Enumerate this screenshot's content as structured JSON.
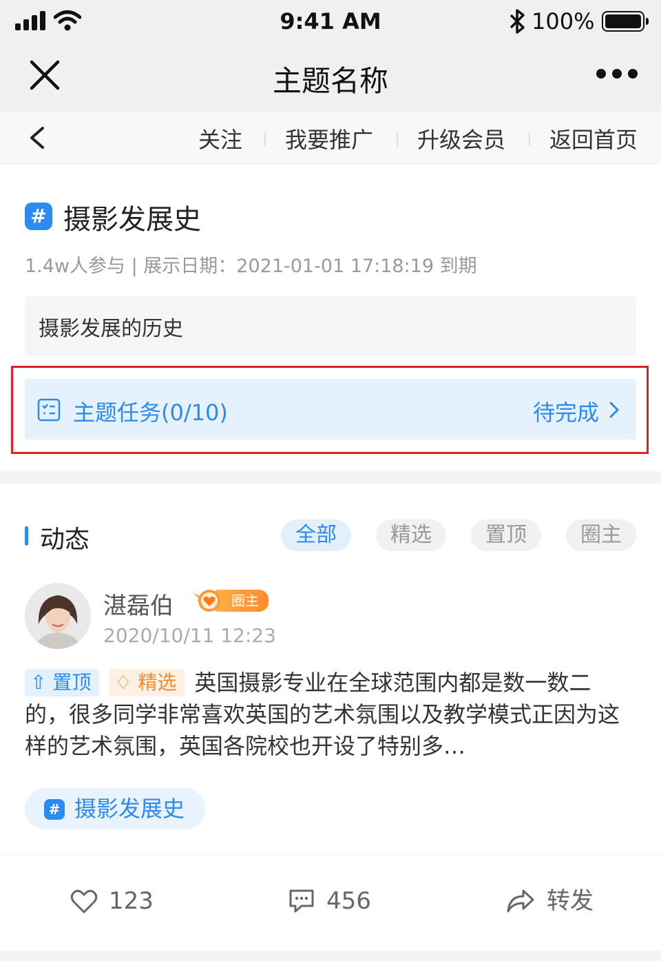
{
  "status_bar": {
    "time": "9:41 AM",
    "battery": "100%"
  },
  "nav": {
    "title": "主题名称"
  },
  "toolbar": {
    "items": [
      "关注",
      "我要推广",
      "升级会员",
      "返回首页"
    ]
  },
  "topic": {
    "hash": "#",
    "title": "摄影发展史",
    "meta": "1.4w人参与 | 展示日期：2021-01-01 17:18:19 到期",
    "description": "摄影发展的历史",
    "task_label": "主题任务(0/10)",
    "task_status": "待完成"
  },
  "feed": {
    "title": "动态",
    "filters": [
      "全部",
      "精选",
      "置顶",
      "圈主"
    ],
    "active_filter": "全部",
    "post": {
      "author": "湛磊伯",
      "badge": "圈主",
      "time": "2020/10/11 12:23",
      "tag_top": "置顶",
      "tag_pick": "精选",
      "text": "英国摄影专业在全球范围内都是数一数二的，很多同学非常喜欢英国的艺术氛围以及教学模式正因为这样的艺术氛围，英国各院校也开设了特别多…",
      "topic": "摄影发展史",
      "likes": "123",
      "comments": "456",
      "share_label": "转发"
    }
  },
  "colors": {
    "accent": "#2b8bf0",
    "highlight_border": "#e0202a",
    "pick": "#f08c2e"
  }
}
